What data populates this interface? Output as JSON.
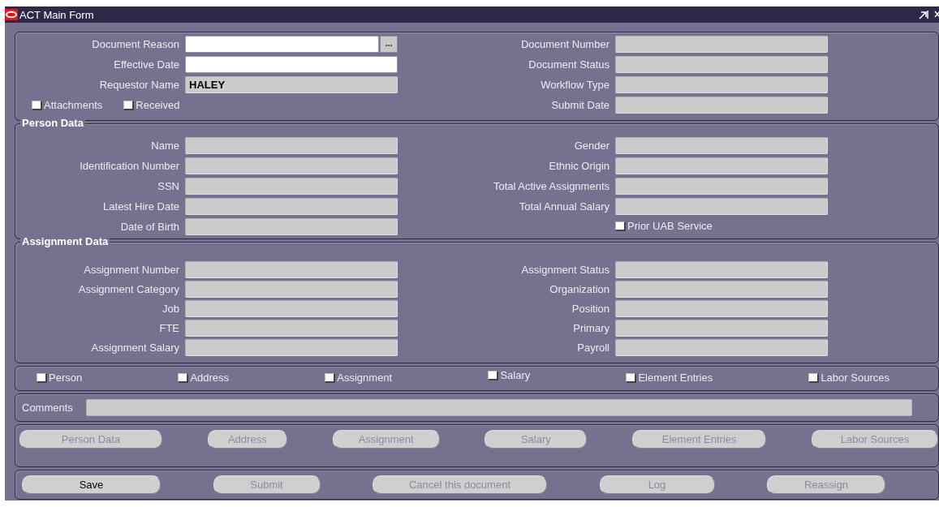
{
  "window": {
    "title": "ACT Main Form"
  },
  "header": {
    "left_fields": [
      {
        "label": "Document Reason",
        "disabled": false,
        "kind": "lov",
        "lov_button": "..."
      },
      {
        "label": "Effective Date",
        "disabled": false,
        "kind": "text"
      },
      {
        "label": "Requestor Name",
        "value": "HALEY",
        "disabled": true,
        "kind": "text"
      }
    ],
    "right_fields": [
      {
        "label": "Document Number",
        "disabled": true,
        "kind": "text"
      },
      {
        "label": "Document Status",
        "disabled": true,
        "kind": "text"
      },
      {
        "label": "Workflow Type",
        "disabled": true,
        "kind": "text"
      },
      {
        "label": "Submit Date",
        "disabled": true,
        "kind": "text"
      }
    ],
    "checkboxes": [
      {
        "label": "Attachments",
        "checked": false
      },
      {
        "label": "Received",
        "checked": false
      }
    ]
  },
  "person_data": {
    "title": "Person Data",
    "left_fields": [
      {
        "label": "Name",
        "disabled": true,
        "kind": "text"
      },
      {
        "label": "Identification Number",
        "disabled": true,
        "kind": "text"
      },
      {
        "label": "SSN",
        "disabled": true,
        "kind": "text"
      },
      {
        "label": "Latest Hire Date",
        "disabled": true,
        "kind": "text"
      },
      {
        "label": "Date of Birth",
        "disabled": true,
        "kind": "text"
      }
    ],
    "right_fields": [
      {
        "label": "Gender",
        "disabled": true,
        "kind": "text"
      },
      {
        "label": "Ethnic Origin",
        "disabled": true,
        "kind": "text"
      },
      {
        "label": "Total Active Assignments",
        "disabled": true,
        "kind": "text"
      },
      {
        "label": "Total Annual Salary",
        "disabled": true,
        "kind": "text"
      }
    ],
    "checkboxes": [
      {
        "label": "Prior UAB Service",
        "checked": false
      }
    ]
  },
  "assignment_data": {
    "title": "Assignment Data",
    "left_fields": [
      {
        "label": "Assignment Number",
        "disabled": true,
        "kind": "text"
      },
      {
        "label": "Assignment Category",
        "disabled": true,
        "kind": "text"
      },
      {
        "label": "Job",
        "disabled": true,
        "kind": "text"
      },
      {
        "label": "FTE",
        "disabled": true,
        "kind": "text"
      },
      {
        "label": "Assignment Salary",
        "disabled": true,
        "kind": "text"
      }
    ],
    "right_fields": [
      {
        "label": "Assignment Status",
        "disabled": true,
        "kind": "text"
      },
      {
        "label": "Organization",
        "disabled": true,
        "kind": "text"
      },
      {
        "label": "Position",
        "disabled": true,
        "kind": "text"
      },
      {
        "label": "Primary",
        "disabled": true,
        "kind": "text"
      },
      {
        "label": "Payroll",
        "disabled": true,
        "kind": "text"
      }
    ]
  },
  "section_checkboxes": [
    {
      "label": "Person",
      "checked": false
    },
    {
      "label": "Address",
      "checked": false
    },
    {
      "label": "Assignment",
      "checked": false
    },
    {
      "label": "Salary",
      "checked": false
    },
    {
      "label": "Element Entries",
      "checked": false
    },
    {
      "label": "Labor Sources",
      "checked": false
    }
  ],
  "comments": {
    "label": "Comments",
    "disabled": true
  },
  "navigation_buttons": [
    {
      "label": "Person Data",
      "disabled": true
    },
    {
      "label": "Address",
      "disabled": true
    },
    {
      "label": "Assignment",
      "disabled": true
    },
    {
      "label": "Salary",
      "disabled": true
    },
    {
      "label": "Element Entries",
      "disabled": true
    },
    {
      "label": "Labor Sources",
      "disabled": true
    }
  ],
  "action_buttons": [
    {
      "label": "Save",
      "disabled": false
    },
    {
      "label": "Submit",
      "disabled": true
    },
    {
      "label": "Cancel this document",
      "disabled": true
    },
    {
      "label": "Log",
      "disabled": true
    },
    {
      "label": "Reassign",
      "disabled": true
    }
  ]
}
